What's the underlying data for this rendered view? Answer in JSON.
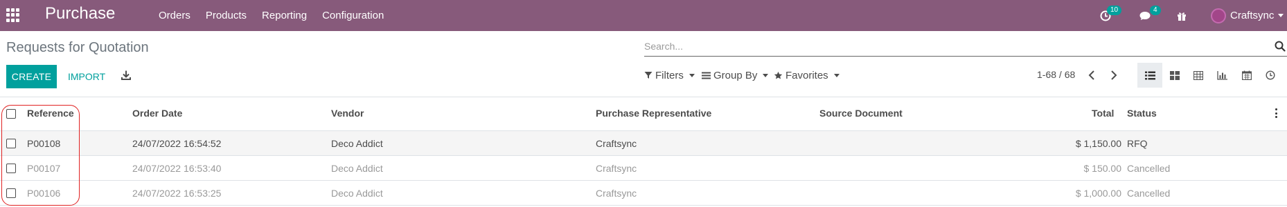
{
  "navbar": {
    "app_title": "Purchase",
    "menu": [
      "Orders",
      "Products",
      "Reporting",
      "Configuration"
    ],
    "activity_count": "10",
    "messages_count": "4",
    "user_name": "Craftsync"
  },
  "control_panel": {
    "breadcrumb": "Requests for Quotation",
    "search_placeholder": "Search...",
    "create_label": "CREATE",
    "import_label": "IMPORT",
    "filters_label": "Filters",
    "groupby_label": "Group By",
    "favorites_label": "Favorites",
    "pager_value": "1-68 / 68",
    "views": [
      "list",
      "kanban",
      "pivot",
      "graph",
      "calendar",
      "activity"
    ],
    "active_view": "list"
  },
  "table": {
    "columns": {
      "reference": "Reference",
      "order_date": "Order Date",
      "vendor": "Vendor",
      "representative": "Purchase Representative",
      "source": "Source Document",
      "total": "Total",
      "status": "Status"
    },
    "rows": [
      {
        "reference": "P00108",
        "order_date": "24/07/2022 16:54:52",
        "vendor": "Deco Addict",
        "representative": "Craftsync",
        "source": "",
        "total": "$ 1,150.00",
        "status": "RFQ"
      },
      {
        "reference": "P00107",
        "order_date": "24/07/2022 16:53:40",
        "vendor": "Deco Addict",
        "representative": "Craftsync",
        "source": "",
        "total": "$ 150.00",
        "status": "Cancelled"
      },
      {
        "reference": "P00106",
        "order_date": "24/07/2022 16:53:25",
        "vendor": "Deco Addict",
        "representative": "Craftsync",
        "source": "",
        "total": "$ 1,000.00",
        "status": "Cancelled"
      }
    ]
  },
  "colors": {
    "navbar": "#875a7b",
    "accent": "#00a09d",
    "annotation": "#e02020",
    "cancelled_text": "#999999"
  }
}
